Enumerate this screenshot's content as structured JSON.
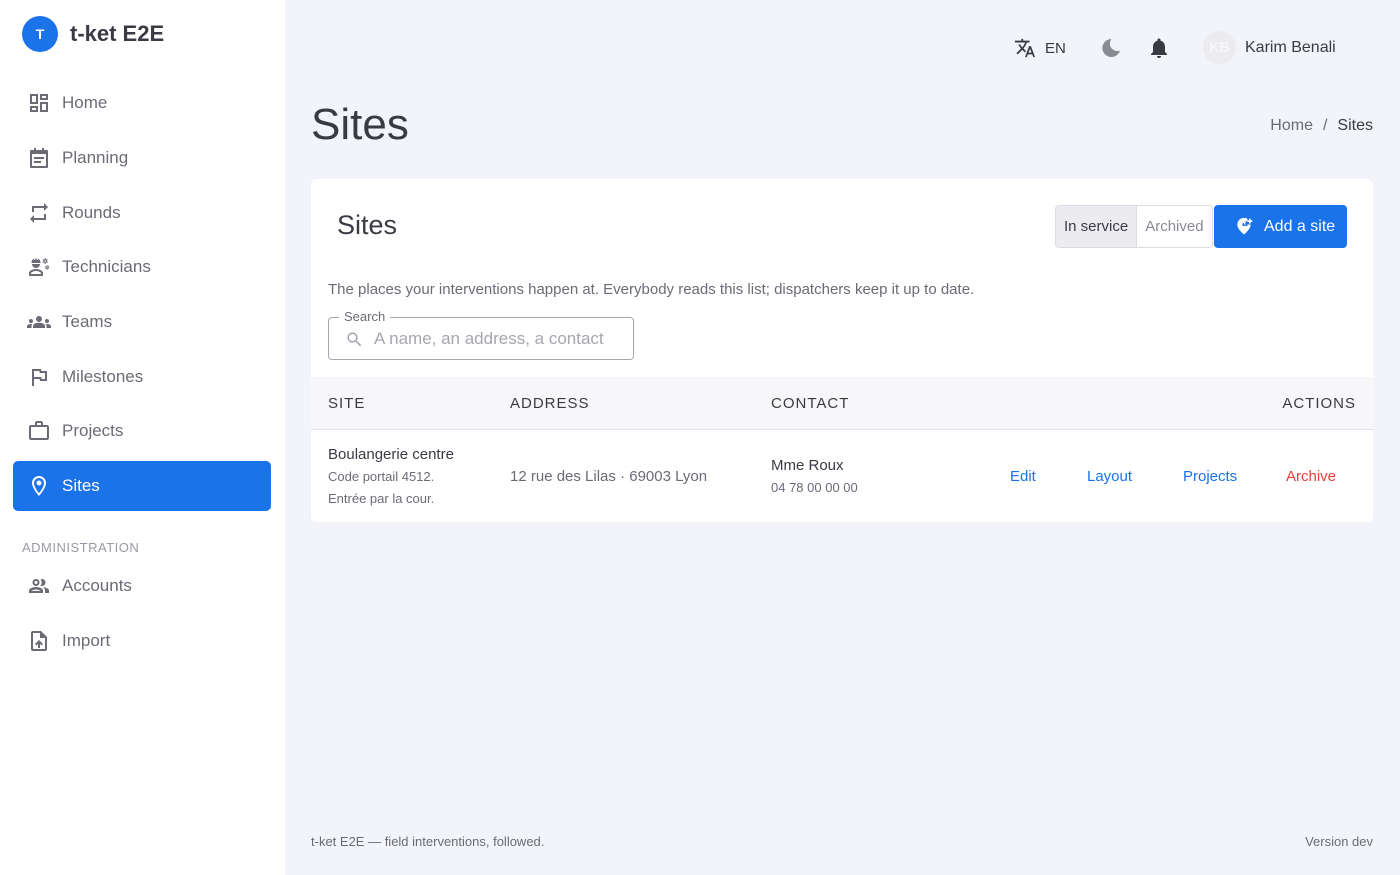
{
  "brand": {
    "initial": "T",
    "name": "t-ket E2E"
  },
  "sidebar": {
    "items": [
      {
        "label": "Home"
      },
      {
        "label": "Planning"
      },
      {
        "label": "Rounds"
      },
      {
        "label": "Technicians"
      },
      {
        "label": "Teams"
      },
      {
        "label": "Milestones"
      },
      {
        "label": "Projects"
      },
      {
        "label": "Sites"
      }
    ],
    "admin_heading": "ADMINISTRATION",
    "admin_items": [
      {
        "label": "Accounts"
      },
      {
        "label": "Import"
      }
    ]
  },
  "topbar": {
    "language": "EN",
    "user": {
      "initials": "KB",
      "name": "Karim Benali"
    }
  },
  "page": {
    "title": "Sites",
    "breadcrumb": {
      "home": "Home",
      "separator": "/",
      "current": "Sites"
    }
  },
  "card": {
    "title": "Sites",
    "toggle": {
      "in_service": "In service",
      "archived": "Archived"
    },
    "add_button": "Add a site",
    "description": "The places your interventions happen at. Everybody reads this list; dispatchers keep it up to date.",
    "search": {
      "legend": "Search",
      "placeholder": "A name, an address, a contact",
      "value": ""
    },
    "table": {
      "headers": {
        "site": "SITE",
        "address": "ADDRESS",
        "contact": "CONTACT",
        "actions": "ACTIONS"
      },
      "rows": [
        {
          "site_name": "Boulangerie centre",
          "site_note_1": "Code portail 4512.",
          "site_note_2": "Entrée par la cour.",
          "address": "12 rue des Lilas · 69003 Lyon",
          "contact_name": "Mme Roux",
          "contact_phone": "04 78 00 00 00",
          "actions": {
            "edit": "Edit",
            "layout": "Layout",
            "projects": "Projects",
            "archive": "Archive"
          }
        }
      ]
    }
  },
  "footer": {
    "tagline": "t-ket E2E — field interventions, followed.",
    "version": "Version dev"
  },
  "colors": {
    "accent": "#1a73e8",
    "danger": "#e53e3e",
    "background": "#f3f4f9"
  }
}
